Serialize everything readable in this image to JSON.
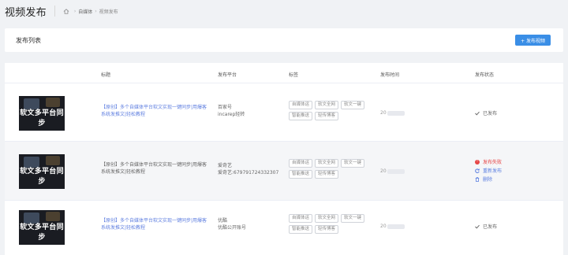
{
  "header": {
    "title": "视频发布",
    "breadcrumb": [
      "自媒体",
      "视频发布"
    ]
  },
  "card": {
    "title": "发布列表",
    "button_label": "+ 发布视频"
  },
  "table": {
    "columns": [
      "标题",
      "发布平台",
      "标签",
      "发布时间",
      "发布状态"
    ],
    "rows": [
      {
        "thumb_title": "软文多平台同步",
        "title": "【原创】多个自媒体平台软文实现一键同步|用爆客系统发推文|轻松教程",
        "platform_lines": [
          "百家号",
          "incarep轻转"
        ],
        "tags": [
          "自媒体运",
          "软文全网",
          "软文一键",
          "智能推送",
          "轻传博客"
        ],
        "time_prefix": "20",
        "status": [
          {
            "icon": "check-icon",
            "text": "已发布",
            "kind": "ok"
          }
        ]
      },
      {
        "thumb_title": "软文多平台同步",
        "title": "【原创】多个自媒体平台软文实现一键同步|用爆客系统发推文|轻松教程",
        "platform_lines": [
          "爱奇艺",
          "爱奇艺:679791724332307"
        ],
        "tags": [
          "自媒体运",
          "软文全网",
          "软文一键",
          "智能推送",
          "轻传博客"
        ],
        "time_prefix": "20",
        "status": [
          {
            "icon": "error-icon",
            "text": "发布失败",
            "kind": "fail"
          },
          {
            "icon": "refresh-icon",
            "text": "重新发布",
            "kind": "act"
          },
          {
            "icon": "trash-icon",
            "text": "删除",
            "kind": "act"
          }
        ]
      },
      {
        "thumb_title": "软文多平台同步",
        "title": "【原创】多个自媒体平台软文实现一键同步|用爆客系统发推文|轻松教程",
        "platform_lines": [
          "优酷",
          "优酷公开账号"
        ],
        "tags": [
          "自媒体运",
          "软文全网",
          "软文一键",
          "智能推送",
          "轻传博客"
        ],
        "time_prefix": "20",
        "status": [
          {
            "icon": "check-icon",
            "text": "已发布",
            "kind": "ok"
          }
        ]
      }
    ]
  },
  "colors": {
    "accent": "#3a8ee6",
    "link": "#5f7fe0",
    "error": "#e64545",
    "background": "#f0f2f5"
  }
}
